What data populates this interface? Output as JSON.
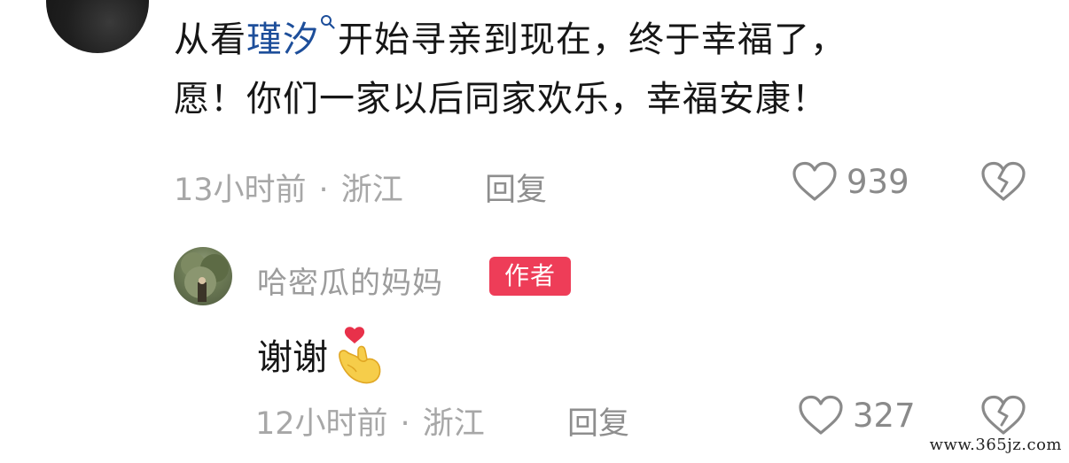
{
  "comment": {
    "text_before_mention": "从看",
    "mention": "瑾汐",
    "text_after_mention": "开始寻亲到现在，终于幸福了，",
    "line2": "愿！你们一家以后同家欢乐，幸福安康！",
    "time": "13小时前",
    "separator": "·",
    "location": "浙江",
    "reply_label": "回复",
    "likes": "939"
  },
  "reply": {
    "author_name": "哈密瓜的妈妈",
    "author_badge": "作者",
    "text": "谢谢",
    "emoji": "heart-hand-emoji",
    "time": "12小时前",
    "separator": "·",
    "location": "浙江",
    "reply_label": "回复",
    "likes": "327"
  },
  "watermark": "www.365jz.com",
  "colors": {
    "mention": "#1d4e9a",
    "meta": "#a7a7a7",
    "badge": "#ee3d58",
    "text": "#161616"
  }
}
